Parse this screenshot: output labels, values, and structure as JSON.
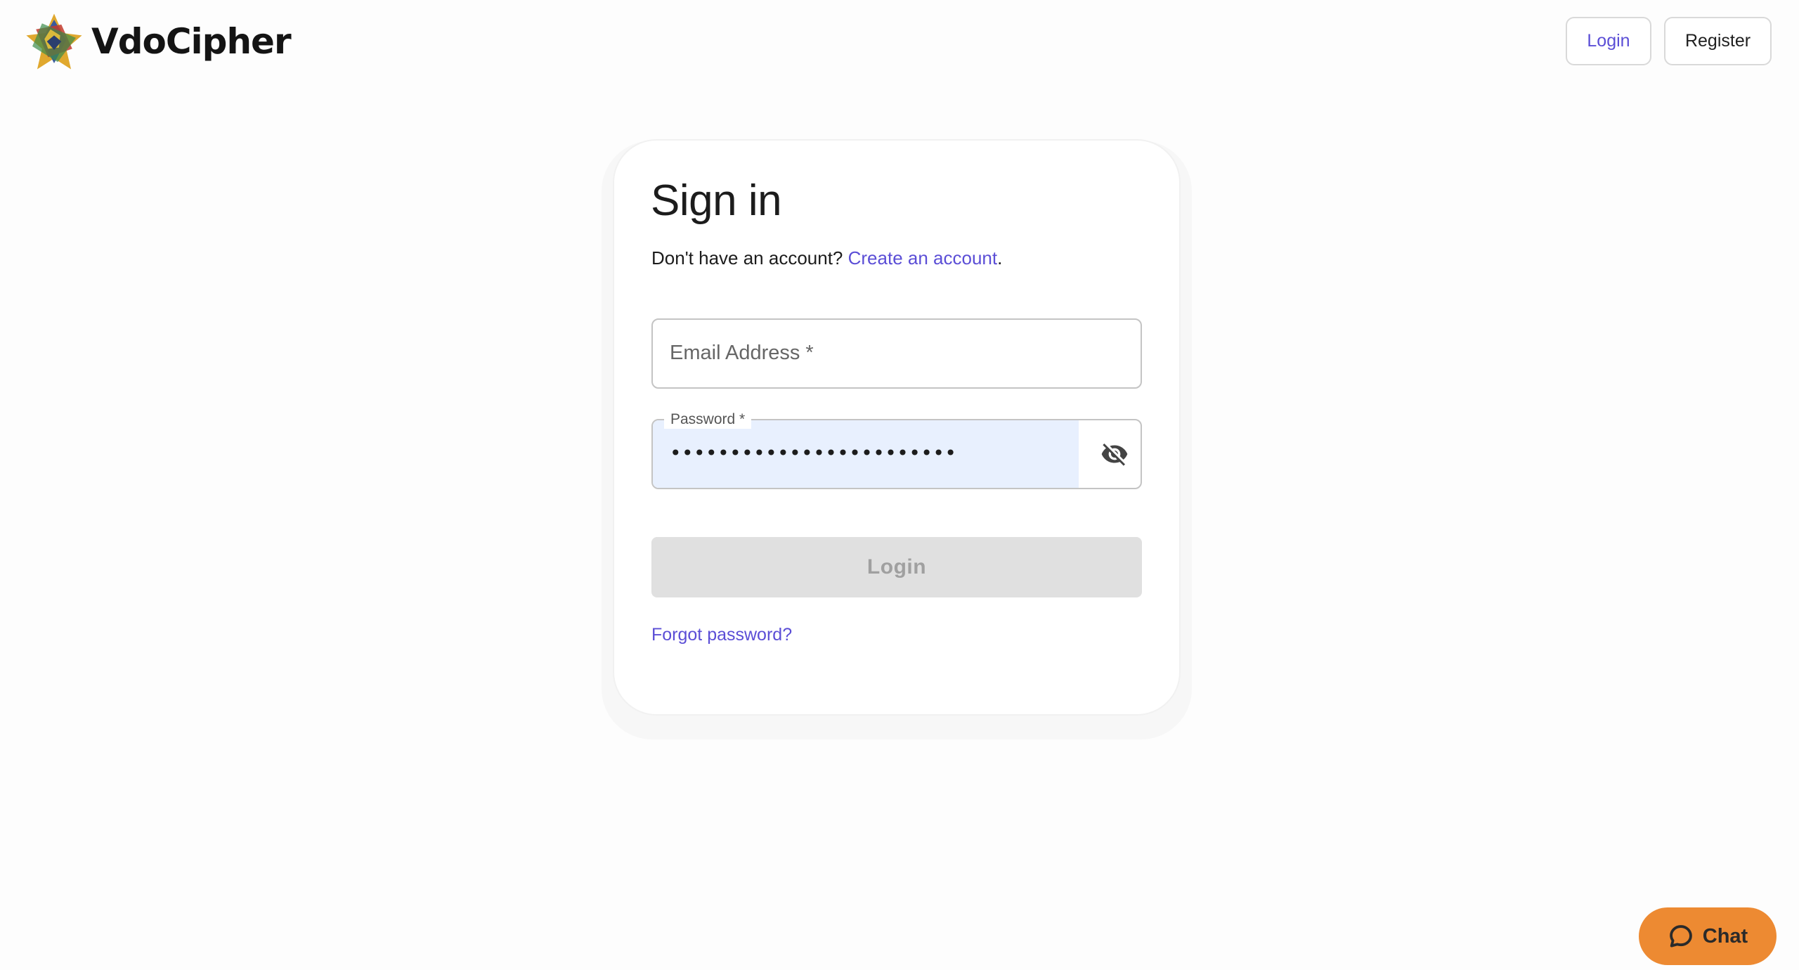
{
  "brand": {
    "name": "VdoCipher",
    "logo_icon": "vdocipher-logo-icon"
  },
  "nav": {
    "login_label": "Login",
    "register_label": "Register"
  },
  "signin": {
    "title": "Sign in",
    "prompt": "Don't have an account?",
    "create_link": "Create an account",
    "create_suffix": ".",
    "email": {
      "label": "Email Address *",
      "value": ""
    },
    "password": {
      "label": "Password *",
      "value": "••••••••••••••••••••••••",
      "toggle_icon": "eye-off-icon"
    },
    "login_button": "Login",
    "forgot_link": "Forgot password?"
  },
  "chat": {
    "label": "Chat",
    "icon": "chat-bubble-icon"
  },
  "colors": {
    "link": "#5b4ed6",
    "chat": "#ed8a32",
    "autofill": "#e8f0fe",
    "disabled_button": "#e0e0e0"
  }
}
